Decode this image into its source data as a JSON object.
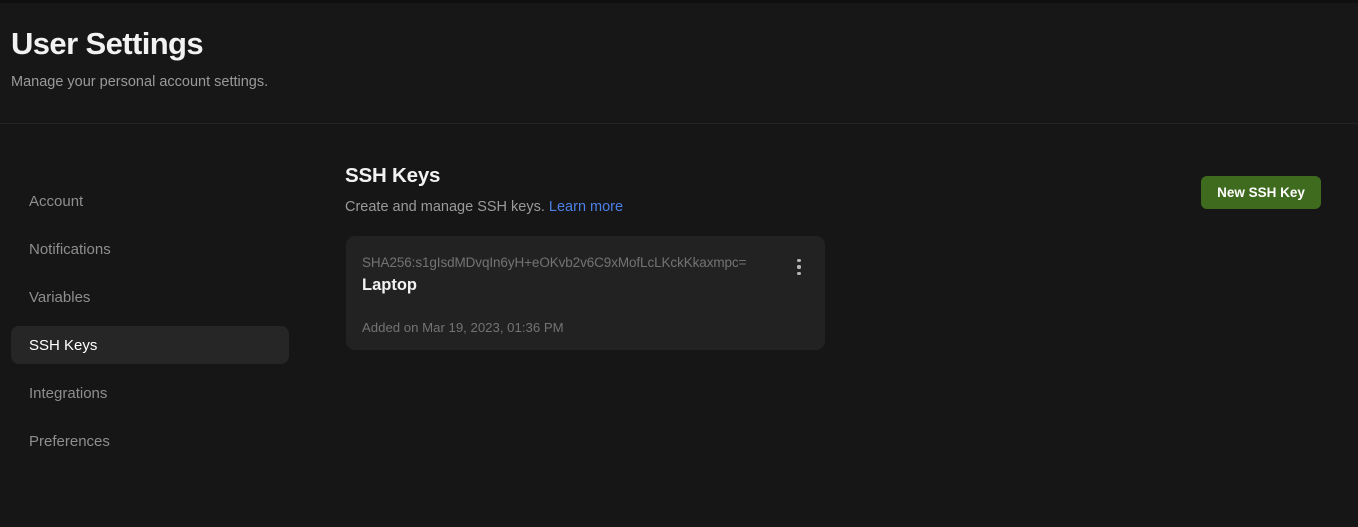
{
  "header": {
    "title": "User Settings",
    "subtitle": "Manage your personal account settings."
  },
  "sidebar": {
    "items": [
      {
        "label": "Account",
        "active": false
      },
      {
        "label": "Notifications",
        "active": false
      },
      {
        "label": "Variables",
        "active": false
      },
      {
        "label": "SSH Keys",
        "active": true
      },
      {
        "label": "Integrations",
        "active": false
      },
      {
        "label": "Preferences",
        "active": false
      }
    ]
  },
  "main": {
    "title": "SSH Keys",
    "subtitle_text": "Create and manage SSH keys.",
    "subtitle_link": "Learn more",
    "new_key_button": "New SSH Key",
    "keys": [
      {
        "fingerprint": "SHA256:s1gIsdMDvqIn6yH+eOKvb2v6C9xMofLcLKckKkaxmpc=",
        "name": "Laptop",
        "added": "Added on Mar 19, 2023, 01:36 PM",
        "menu_icon": "kebab-menu-icon"
      }
    ]
  },
  "colors": {
    "page_bg": "#161616",
    "header_bg": "#171717",
    "card_bg": "#222222",
    "active_nav_bg": "#262626",
    "accent_green": "#3f6b1e",
    "link_blue": "#4c80e8",
    "text_primary": "#f2f2f2",
    "text_muted": "#9a9a9a",
    "text_dim": "#737373"
  }
}
